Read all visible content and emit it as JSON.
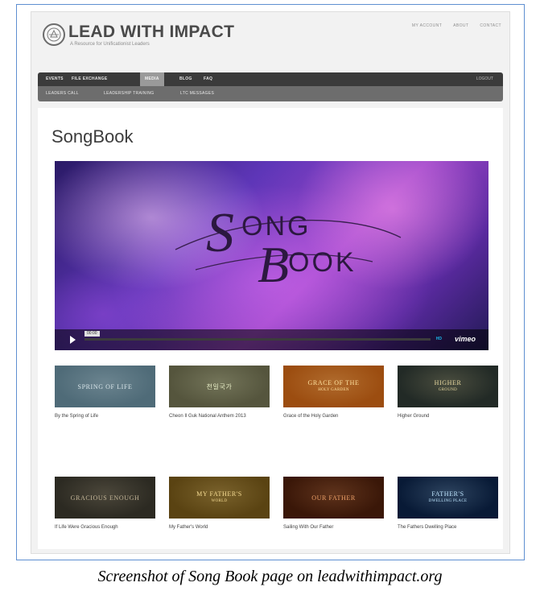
{
  "site": {
    "title": "LEAD WITH IMPACT",
    "tagline": "A Resource for Unificationist Leaders",
    "top_links": [
      "MY ACCOUNT",
      "ABOUT",
      "CONTACT"
    ]
  },
  "nav": {
    "main": [
      {
        "label": "EVENTS",
        "active": false
      },
      {
        "label": "FILE EXCHANGE",
        "active": false
      },
      {
        "label": "MEDIA",
        "active": true
      },
      {
        "label": "BLOG",
        "active": false
      },
      {
        "label": "FAQ",
        "active": false
      }
    ],
    "login": "LOGOUT",
    "sub": [
      "LEADERS CALL",
      "LEADERSHIP TRAINING",
      "LTC MESSAGES"
    ]
  },
  "page": {
    "title": "SongBook"
  },
  "video": {
    "title_line1": "ONG",
    "title_line2": "OOK",
    "title_initial1": "S",
    "title_initial2": "B",
    "time": "00:00",
    "progress": 0.0,
    "provider": "vimeo",
    "hd": "HD"
  },
  "songs": [
    {
      "title": "By the Spring of Life",
      "thumb_text": "Spring of Life",
      "thumb_sub": "",
      "bg": "#4f6b78",
      "fg": "#d9e6ea"
    },
    {
      "title": "Cheon Il Guk National Anthem 2013",
      "thumb_text": "천일국가",
      "thumb_sub": "",
      "bg": "#55553d",
      "fg": "#e9efc8"
    },
    {
      "title": "Grace of the Holy Garden",
      "thumb_text": "Grace of the",
      "thumb_sub": "Holy Garden",
      "bg": "#9c4d10",
      "fg": "#ffe2a0"
    },
    {
      "title": "Higher Ground",
      "thumb_text": "Higher",
      "thumb_sub": "Ground",
      "bg": "#222a26",
      "fg": "#e8d8a0"
    },
    {
      "title": "If Life Were Gracious Enough",
      "thumb_text": "Gracious Enough",
      "thumb_sub": "",
      "bg": "#2c2a22",
      "fg": "#c7b99b"
    },
    {
      "title": "My Father's World",
      "thumb_text": "My Father's",
      "thumb_sub": "World",
      "bg": "#5a4312",
      "fg": "#f6dc93"
    },
    {
      "title": "Sailing With Our Father",
      "thumb_text": "Our Father",
      "thumb_sub": "",
      "bg": "#3a1708",
      "fg": "#f0a36a"
    },
    {
      "title": "The Fathers Dwelling Place",
      "thumb_text": "Father's",
      "thumb_sub": "Dwelling Place",
      "bg": "#081a36",
      "fg": "#bfe6ff"
    }
  ],
  "caption": "Screenshot of Song Book page on leadwithimpact.org"
}
